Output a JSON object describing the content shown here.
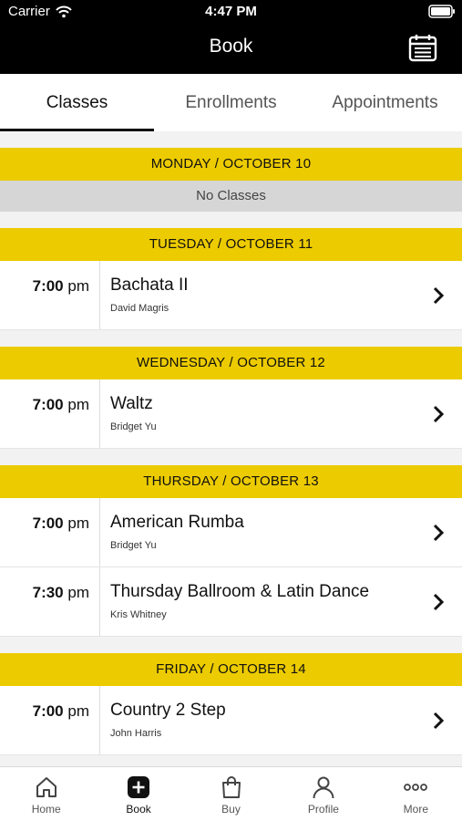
{
  "status_bar": {
    "carrier": "Carrier",
    "time": "4:47 PM"
  },
  "nav": {
    "title": "Book",
    "calendar_icon": "calendar-icon"
  },
  "tabs": [
    {
      "label": "Classes",
      "active": true
    },
    {
      "label": "Enrollments",
      "active": false
    },
    {
      "label": "Appointments",
      "active": false
    }
  ],
  "days": [
    {
      "header": "MONDAY / OCTOBER 10",
      "empty_text": "No Classes"
    },
    {
      "header": "TUESDAY / OCTOBER 11",
      "classes": [
        {
          "time": "7:00",
          "ampm": "pm",
          "name": "Bachata II",
          "instructor": "David Magris"
        }
      ]
    },
    {
      "header": "WEDNESDAY / OCTOBER 12",
      "classes": [
        {
          "time": "7:00",
          "ampm": "pm",
          "name": "Waltz",
          "instructor": "Bridget Yu"
        }
      ]
    },
    {
      "header": "THURSDAY / OCTOBER 13",
      "classes": [
        {
          "time": "7:00",
          "ampm": "pm",
          "name": "American Rumba",
          "instructor": "Bridget Yu"
        },
        {
          "time": "7:30",
          "ampm": "pm",
          "name": "Thursday Ballroom & Latin Dance",
          "instructor": "Kris Whitney"
        }
      ]
    },
    {
      "header": "FRIDAY / OCTOBER 14",
      "classes": [
        {
          "time": "7:00",
          "ampm": "pm",
          "name": "Country 2 Step",
          "instructor": "John Harris"
        }
      ]
    }
  ],
  "bottom_nav": [
    {
      "label": "Home",
      "icon": "home-icon",
      "active": false
    },
    {
      "label": "Book",
      "icon": "plus-square-icon",
      "active": true
    },
    {
      "label": "Buy",
      "icon": "shopping-bag-icon",
      "active": false
    },
    {
      "label": "Profile",
      "icon": "user-icon",
      "active": false
    },
    {
      "label": "More",
      "icon": "more-dots-icon",
      "active": false
    }
  ],
  "colors": {
    "header_bg": "#000000",
    "accent_yellow": "#ECCB00",
    "no_classes_bg": "#D6D6D6"
  }
}
